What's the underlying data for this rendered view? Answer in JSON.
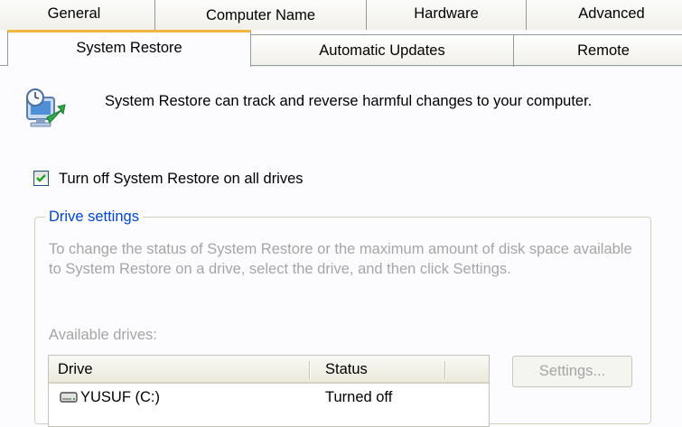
{
  "tabs": {
    "row1": [
      "General",
      "Computer Name",
      "Hardware",
      "Advanced"
    ],
    "row2": [
      "System Restore",
      "Automatic Updates",
      "Remote"
    ],
    "active": "System Restore"
  },
  "intro": {
    "icon": "system-restore-icon",
    "text": "System Restore can track and reverse harmful changes to your computer."
  },
  "turn_off": {
    "label": "Turn off System Restore on all drives",
    "checked": true
  },
  "drive_settings": {
    "legend": "Drive settings",
    "description": "To change the status of System Restore or the maximum amount of disk space available to System Restore on a drive, select the drive, and then click Settings.",
    "available_label": "Available drives:",
    "columns": [
      "Drive",
      "Status"
    ],
    "drives": [
      {
        "name": "YUSUF (C:)",
        "status": "Turned off",
        "icon": "hard-drive-icon"
      }
    ],
    "settings_button": "Settings..."
  },
  "colors": {
    "accent_tab": "#f5b63d",
    "legend_blue": "#0046d5",
    "disabled_text": "#a5a5a5",
    "check_green": "#21a121"
  }
}
